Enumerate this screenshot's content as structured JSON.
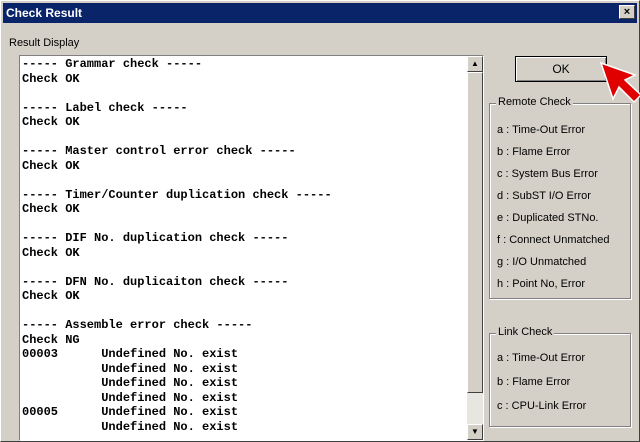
{
  "window": {
    "title": "Check Result",
    "close_label": "×"
  },
  "result": {
    "label": "Result Display",
    "lines": [
      "----- Grammar check -----",
      "Check OK",
      "",
      "----- Label check -----",
      "Check OK",
      "",
      "----- Master control error check -----",
      "Check OK",
      "",
      "----- Timer/Counter duplication check -----",
      "Check OK",
      "",
      "----- DIF No. duplication check -----",
      "Check OK",
      "",
      "----- DFN No. duplicaiton check -----",
      "Check OK",
      "",
      "----- Assemble error check -----",
      "Check NG",
      "00003      Undefined No. exist",
      "           Undefined No. exist",
      "           Undefined No. exist",
      "           Undefined No. exist",
      "00005      Undefined No. exist",
      "           Undefined No. exist"
    ]
  },
  "ok_button": {
    "label": "OK"
  },
  "remote_check": {
    "title": "Remote Check",
    "items": [
      "a : Time-Out Error",
      "b : Flame Error",
      "c : System Bus Error",
      "d : SubST I/O Error",
      "e : Duplicated STNo.",
      "f : Connect Unmatched",
      "g : I/O Unmatched",
      "h : Point No, Error"
    ]
  },
  "link_check": {
    "title": "Link Check",
    "items": [
      "a : Time-Out Error",
      "b : Flame Error",
      "c : CPU-Link Error"
    ]
  },
  "colors": {
    "titlebar": "#0a246a",
    "face": "#d4d0c8",
    "cursor": "#e00000"
  }
}
